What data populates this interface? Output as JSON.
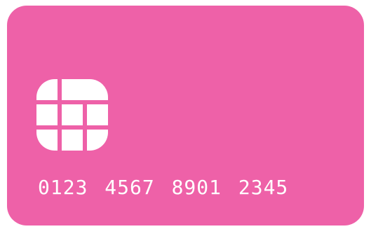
{
  "card": {
    "number": "0123 4567 8901 2345",
    "background_color": "#EE61A8",
    "foreground_color": "#FFFFFF"
  },
  "icons": {
    "chip": "chip-icon"
  }
}
